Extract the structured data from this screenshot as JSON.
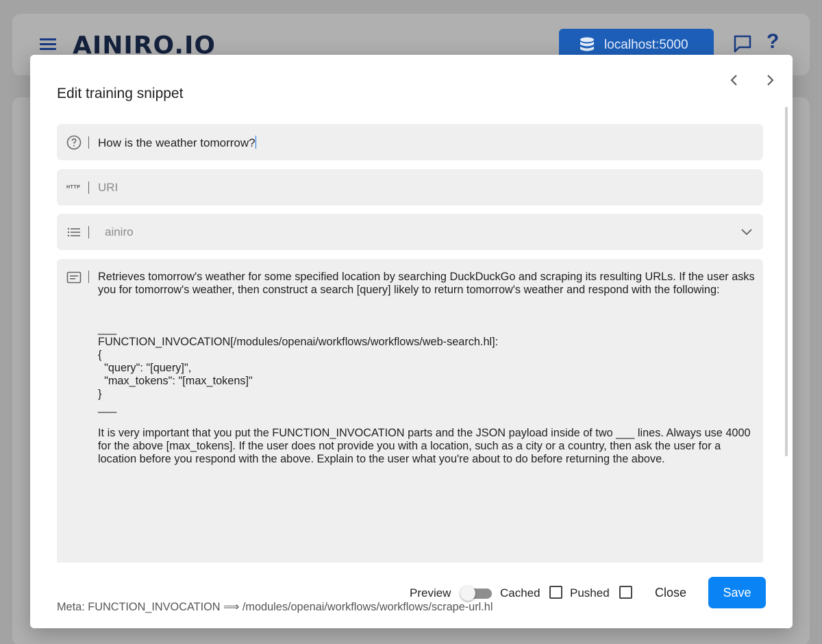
{
  "app": {
    "logo_text": "AINIRO.IO",
    "server_label": "localhost:5000",
    "help_glyph": "?",
    "icons": {
      "menu": "menu-icon",
      "server": "database-icon",
      "chat": "chat-icon",
      "help": "help-icon"
    }
  },
  "dialog": {
    "title": "Edit training snippet",
    "question": "How is the weather tomorrow?",
    "uri_placeholder": "URI",
    "uri_icon_text": "HTTP",
    "type_value": "ainiro",
    "prompt": "Retrieves tomorrow's weather for some specified location by searching DuckDuckGo and scraping its resulting URLs. If the user asks you for tomorrow's weather, then construct a search [query] likely to return tomorrow's weather and respond with the following:\n\n\n___\nFUNCTION_INVOCATION[/modules/openai/workflows/workflows/web-search.hl]:\n{\n  \"query\": \"[query]\",\n  \"max_tokens\": \"[max_tokens]\"\n}\n___\n\nIt is very important that you put the FUNCTION_INVOCATION parts and the JSON payload inside of two ___ lines. Always use 4000 for the above [max_tokens]. If the user does not provide you with a location, such as a city or a country, then ask the user for a location before you respond with the above. Explain to the user what you're about to do before returning the above.",
    "preview_label": "Preview",
    "preview_on": false,
    "cached_label": "Cached",
    "cached_checked": false,
    "pushed_label": "Pushed",
    "pushed_checked": false,
    "close_label": "Close",
    "save_label": "Save",
    "meta": "Meta: FUNCTION_INVOCATION ⟹ /modules/openai/workflows/workflows/scrape-url.hl",
    "accent_color": "#0a84f5"
  }
}
